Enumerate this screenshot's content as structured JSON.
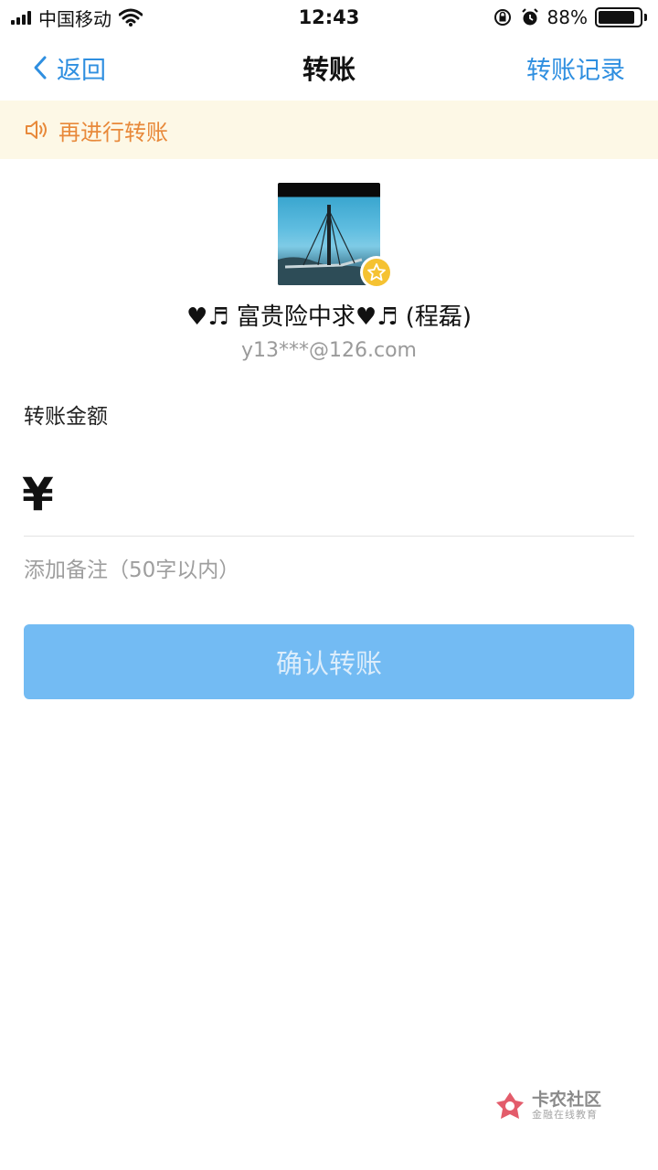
{
  "status_bar": {
    "carrier": "中国移动",
    "time": "12:43",
    "battery_percent": "88%",
    "battery_level": 0.88,
    "icons": [
      "signal-icon",
      "wifi-icon",
      "rotation-lock-icon",
      "alarm-icon",
      "battery-icon"
    ]
  },
  "nav": {
    "back_label": "返回",
    "title": "转账",
    "right_label": "转账记录"
  },
  "notice": {
    "text": "再进行转账",
    "icon": "speaker-icon",
    "color": "#e8893a"
  },
  "recipient": {
    "name": "♥♬ 富贵险中求♥♬ (程磊)",
    "email": "y13***@126.com",
    "badge_icon": "star-icon"
  },
  "transfer": {
    "amount_label": "转账金额",
    "currency_symbol": "¥",
    "amount_value": "",
    "remark_placeholder": "添加备注（50字以内）"
  },
  "confirm_button": {
    "label": "确认转账",
    "color": "#73bbf3"
  },
  "watermark": {
    "title": "卡农社区",
    "subtitle": "金融在线教育"
  },
  "colors": {
    "accent": "#2f8fe0",
    "notice_bg": "#fdf8e6"
  }
}
